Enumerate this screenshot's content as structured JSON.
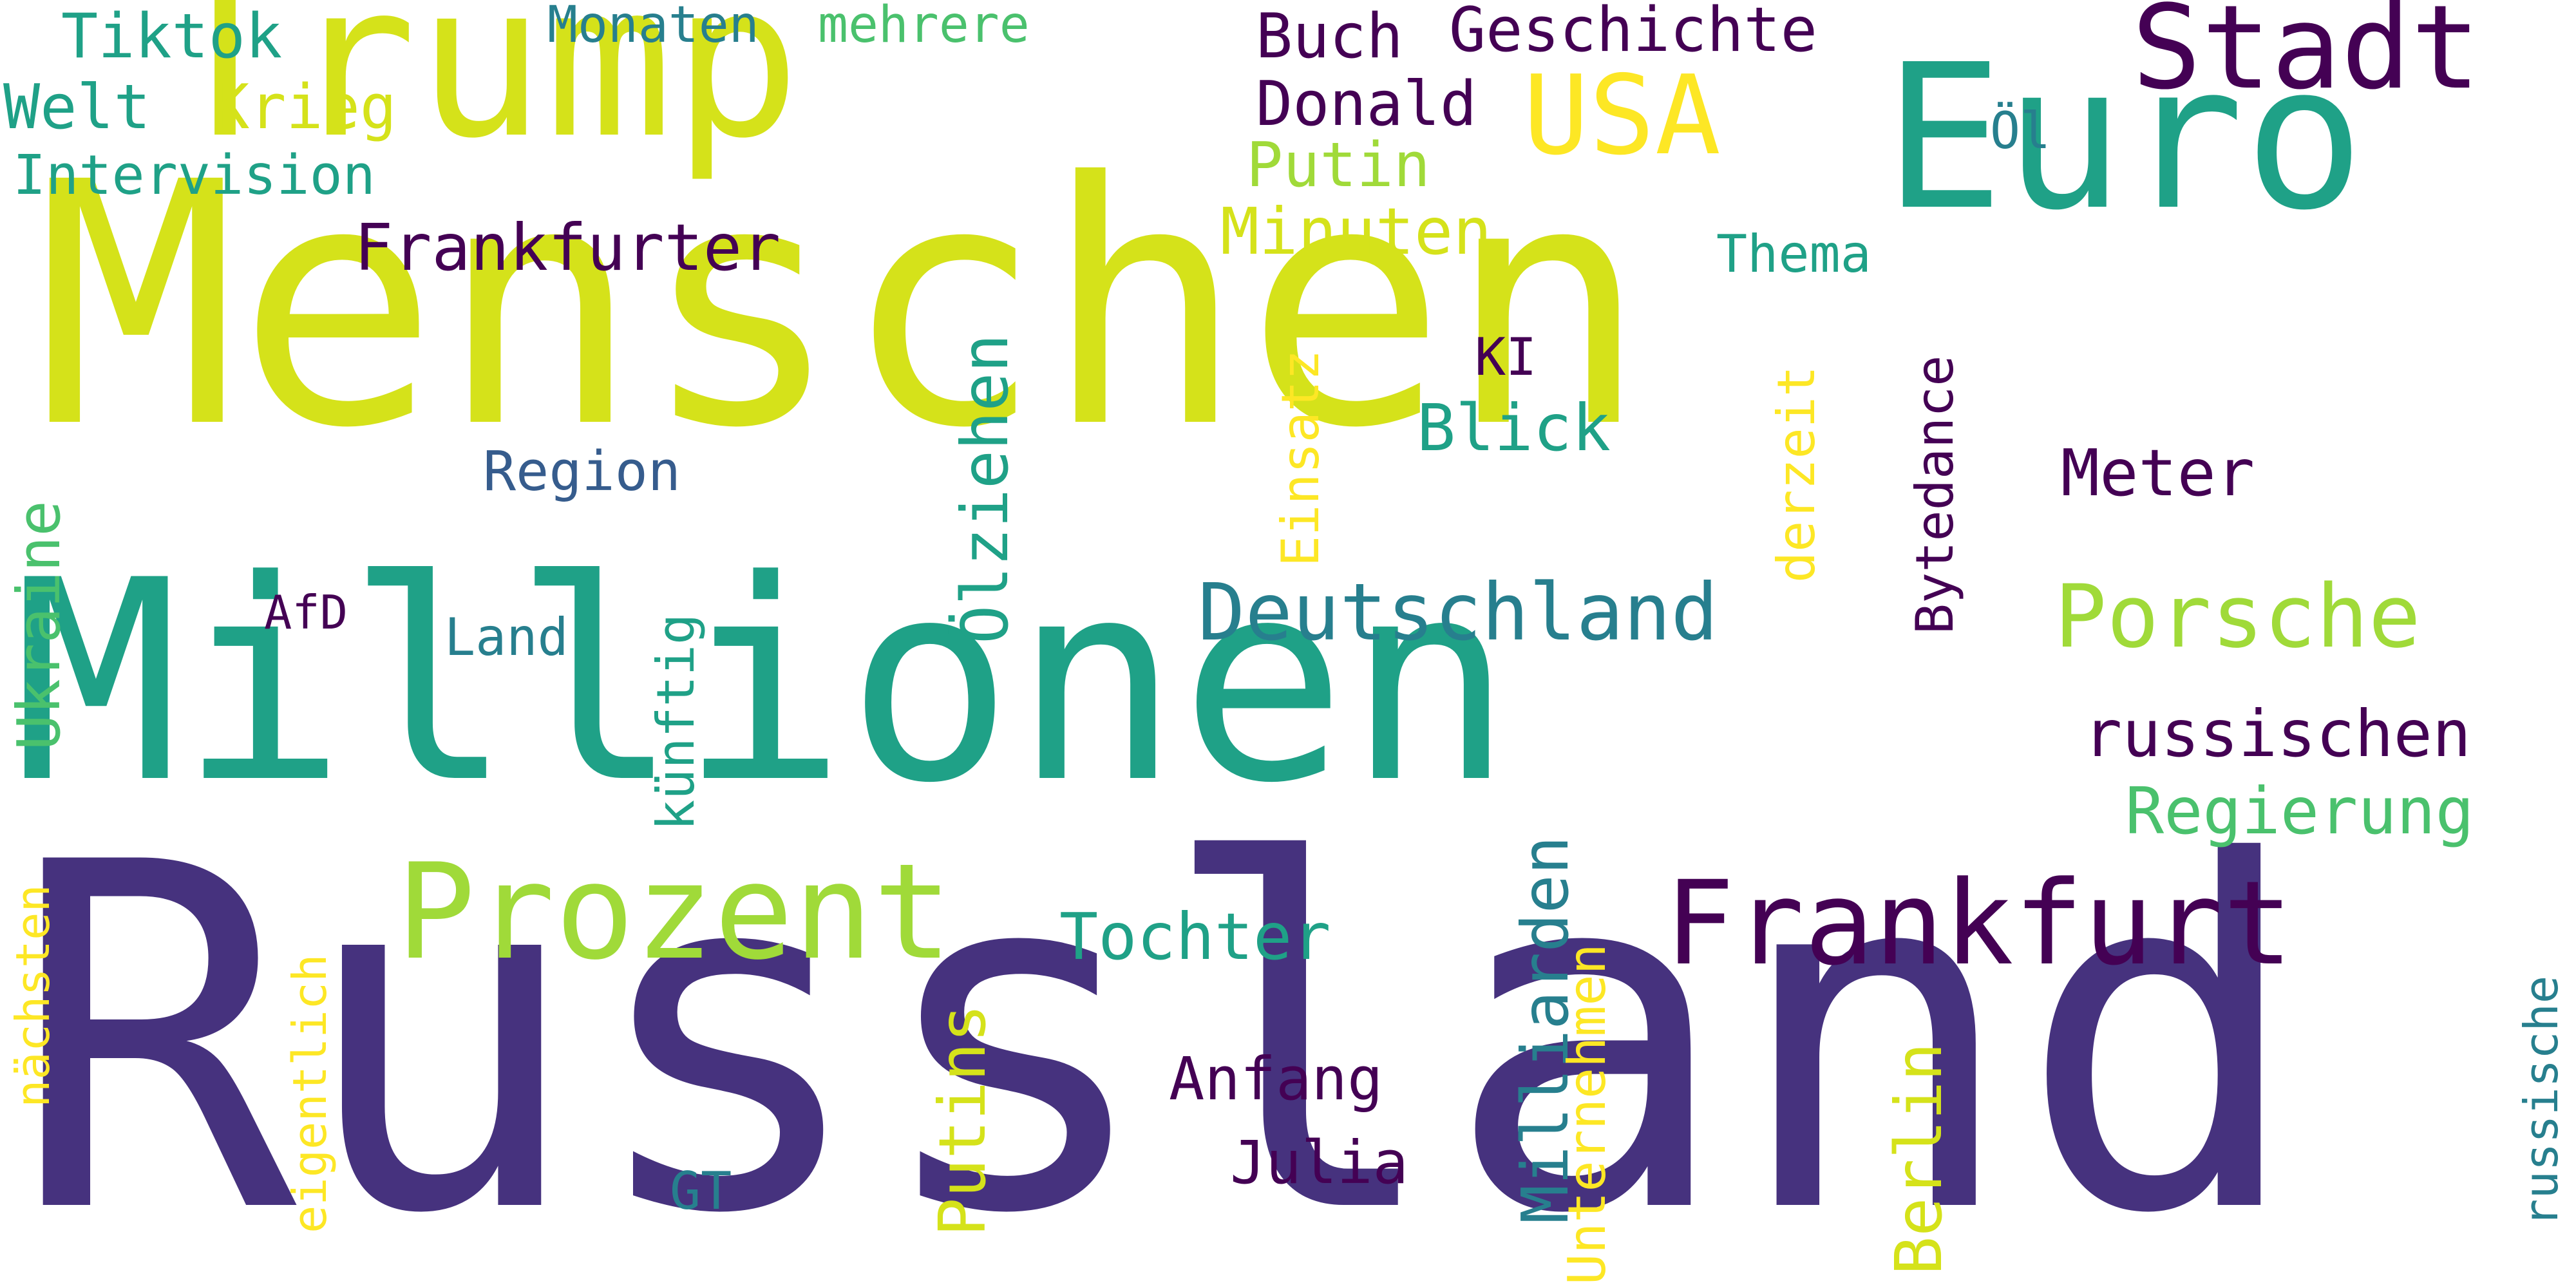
{
  "palette": {
    "c1": "#440154",
    "c2": "#46327e",
    "c3": "#365c8d",
    "c4": "#277f8e",
    "c5": "#1fa187",
    "c6": "#4ac16d",
    "c7": "#a0da39",
    "c8": "#d5e21a",
    "c9": "#fde725"
  },
  "words": [
    {
      "text": "Menschen",
      "color": "c8"
    },
    {
      "text": "Russland",
      "color": "c2"
    },
    {
      "text": "Millionen",
      "color": "c5"
    },
    {
      "text": "Trump",
      "color": "c8"
    },
    {
      "text": "Euro",
      "color": "c5"
    },
    {
      "text": "Prozent",
      "color": "c7"
    },
    {
      "text": "Frankfurt",
      "color": "c1"
    },
    {
      "text": "Stadt",
      "color": "c1"
    },
    {
      "text": "USA",
      "color": "c9"
    },
    {
      "text": "Porsche",
      "color": "c7"
    },
    {
      "text": "Deutschland",
      "color": "c4"
    },
    {
      "text": "Frankfurter",
      "color": "c1"
    },
    {
      "text": "Ölziehen",
      "color": "c5"
    },
    {
      "text": "Milliarden",
      "color": "c4"
    },
    {
      "text": "Minuten",
      "color": "c8"
    },
    {
      "text": "Geschichte",
      "color": "c1"
    },
    {
      "text": "Tiktok",
      "color": "c5"
    },
    {
      "text": "Welt",
      "color": "c5"
    },
    {
      "text": "Krieg",
      "color": "c8"
    },
    {
      "text": "Intervision",
      "color": "c5"
    },
    {
      "text": "Monaten",
      "color": "c4"
    },
    {
      "text": "mehrere",
      "color": "c6"
    },
    {
      "text": "Buch",
      "color": "c1"
    },
    {
      "text": "Donald",
      "color": "c1"
    },
    {
      "text": "Putin",
      "color": "c7"
    },
    {
      "text": "Öl",
      "color": "c4"
    },
    {
      "text": "Thema",
      "color": "c5"
    },
    {
      "text": "KI",
      "color": "c1"
    },
    {
      "text": "Blick",
      "color": "c5"
    },
    {
      "text": "Einsatz",
      "color": "c9"
    },
    {
      "text": "derzeit",
      "color": "c9"
    },
    {
      "text": "Bytedance",
      "color": "c1"
    },
    {
      "text": "Meter",
      "color": "c1"
    },
    {
      "text": "Region",
      "color": "c3"
    },
    {
      "text": "Ukraine",
      "color": "c6"
    },
    {
      "text": "AfD",
      "color": "c1"
    },
    {
      "text": "Land",
      "color": "c4"
    },
    {
      "text": "künftig",
      "color": "c5"
    },
    {
      "text": "russischen",
      "color": "c1"
    },
    {
      "text": "Regierung",
      "color": "c6"
    },
    {
      "text": "Tochter",
      "color": "c5"
    },
    {
      "text": "nächsten",
      "color": "c9"
    },
    {
      "text": "eigentlich",
      "color": "c9"
    },
    {
      "text": "Putins",
      "color": "c8"
    },
    {
      "text": "Anfang",
      "color": "c1"
    },
    {
      "text": "Julia",
      "color": "c1"
    },
    {
      "text": "GT",
      "color": "c4"
    },
    {
      "text": "Unternehmen",
      "color": "c9"
    },
    {
      "text": "Berlin",
      "color": "c8"
    },
    {
      "text": "russische",
      "color": "c4"
    }
  ]
}
